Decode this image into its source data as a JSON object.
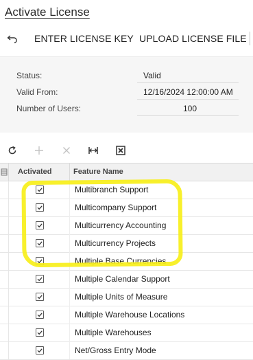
{
  "page": {
    "title": "Activate License"
  },
  "toolbar": {
    "undo_icon": "undo-icon",
    "enter_license_key": "ENTER LICENSE KEY",
    "upload_license_file": "UPLOAD LICENSE FILE"
  },
  "summary": {
    "status_label": "Status:",
    "status_value": "Valid",
    "valid_from_label": "Valid From:",
    "valid_from_value": "12/16/2024 12:00:00 AM",
    "users_label": "Number of Users:",
    "users_value": "100"
  },
  "grid_toolbar": {
    "icons": [
      "refresh-icon",
      "add-icon",
      "delete-icon",
      "fit-columns-icon",
      "export-excel-icon"
    ]
  },
  "grid": {
    "columns": {
      "activated": "Activated",
      "feature_name": "Feature Name"
    },
    "rows": [
      {
        "activated": true,
        "feature": "Multibranch Support"
      },
      {
        "activated": true,
        "feature": "Multicompany Support"
      },
      {
        "activated": true,
        "feature": "Multicurrency Accounting"
      },
      {
        "activated": true,
        "feature": "Multicurrency Projects"
      },
      {
        "activated": true,
        "feature": "Multiple Base Currencies"
      },
      {
        "activated": true,
        "feature": "Multiple Calendar Support"
      },
      {
        "activated": true,
        "feature": "Multiple Units of Measure"
      },
      {
        "activated": true,
        "feature": "Multiple Warehouse Locations"
      },
      {
        "activated": true,
        "feature": "Multiple Warehouses"
      },
      {
        "activated": true,
        "feature": "Net/Gross Entry Mode"
      }
    ]
  },
  "colors": {
    "highlight": "#f7ef1a",
    "header_bg": "#f1f1f1",
    "summary_bg": "#f6f6f6"
  }
}
